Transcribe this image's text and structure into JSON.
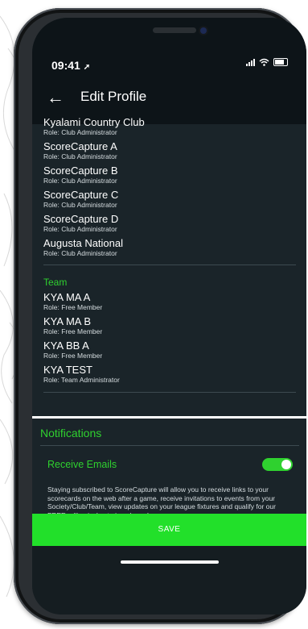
{
  "colors": {
    "accent": "#2fd12f",
    "save_button": "#22e02a",
    "screen_background": "#1a2429",
    "header_background": "#0d1418"
  },
  "status_bar": {
    "time": "09:41"
  },
  "header": {
    "title": "Edit Profile",
    "back_icon": "arrow-left-icon"
  },
  "clubs": [
    {
      "name": "Kyalami Country Club",
      "role": "Role: Club Administrator"
    },
    {
      "name": "ScoreCapture A",
      "role": "Role: Club Administrator"
    },
    {
      "name": "ScoreCapture B",
      "role": "Role: Club Administrator"
    },
    {
      "name": "ScoreCapture C",
      "role": "Role: Club Administrator"
    },
    {
      "name": "ScoreCapture D",
      "role": "Role: Club Administrator"
    },
    {
      "name": "Augusta National",
      "role": "Role: Club Administrator"
    }
  ],
  "team_section": {
    "label": "Team",
    "items": [
      {
        "name": "KYA MA A",
        "role": "Role: Free Member"
      },
      {
        "name": "KYA MA B",
        "role": "Role: Free Member"
      },
      {
        "name": "KYA BB A",
        "role": "Role: Free Member"
      },
      {
        "name": "KYA TEST",
        "role": "Role: Team Administrator"
      }
    ]
  },
  "notifications": {
    "title": "Notifications",
    "receive_emails_label": "Receive Emails",
    "receive_emails_enabled": true,
    "description": "Staying subscribed to ScoreCapture will allow you to receive links to your scorecards on the web after a game, receive invitations to events from your Society/Club/Team, view updates on your league fixtures and qualify for our FREE rolling jackpot give-always!"
  },
  "save_button": {
    "label": "SAVE"
  }
}
